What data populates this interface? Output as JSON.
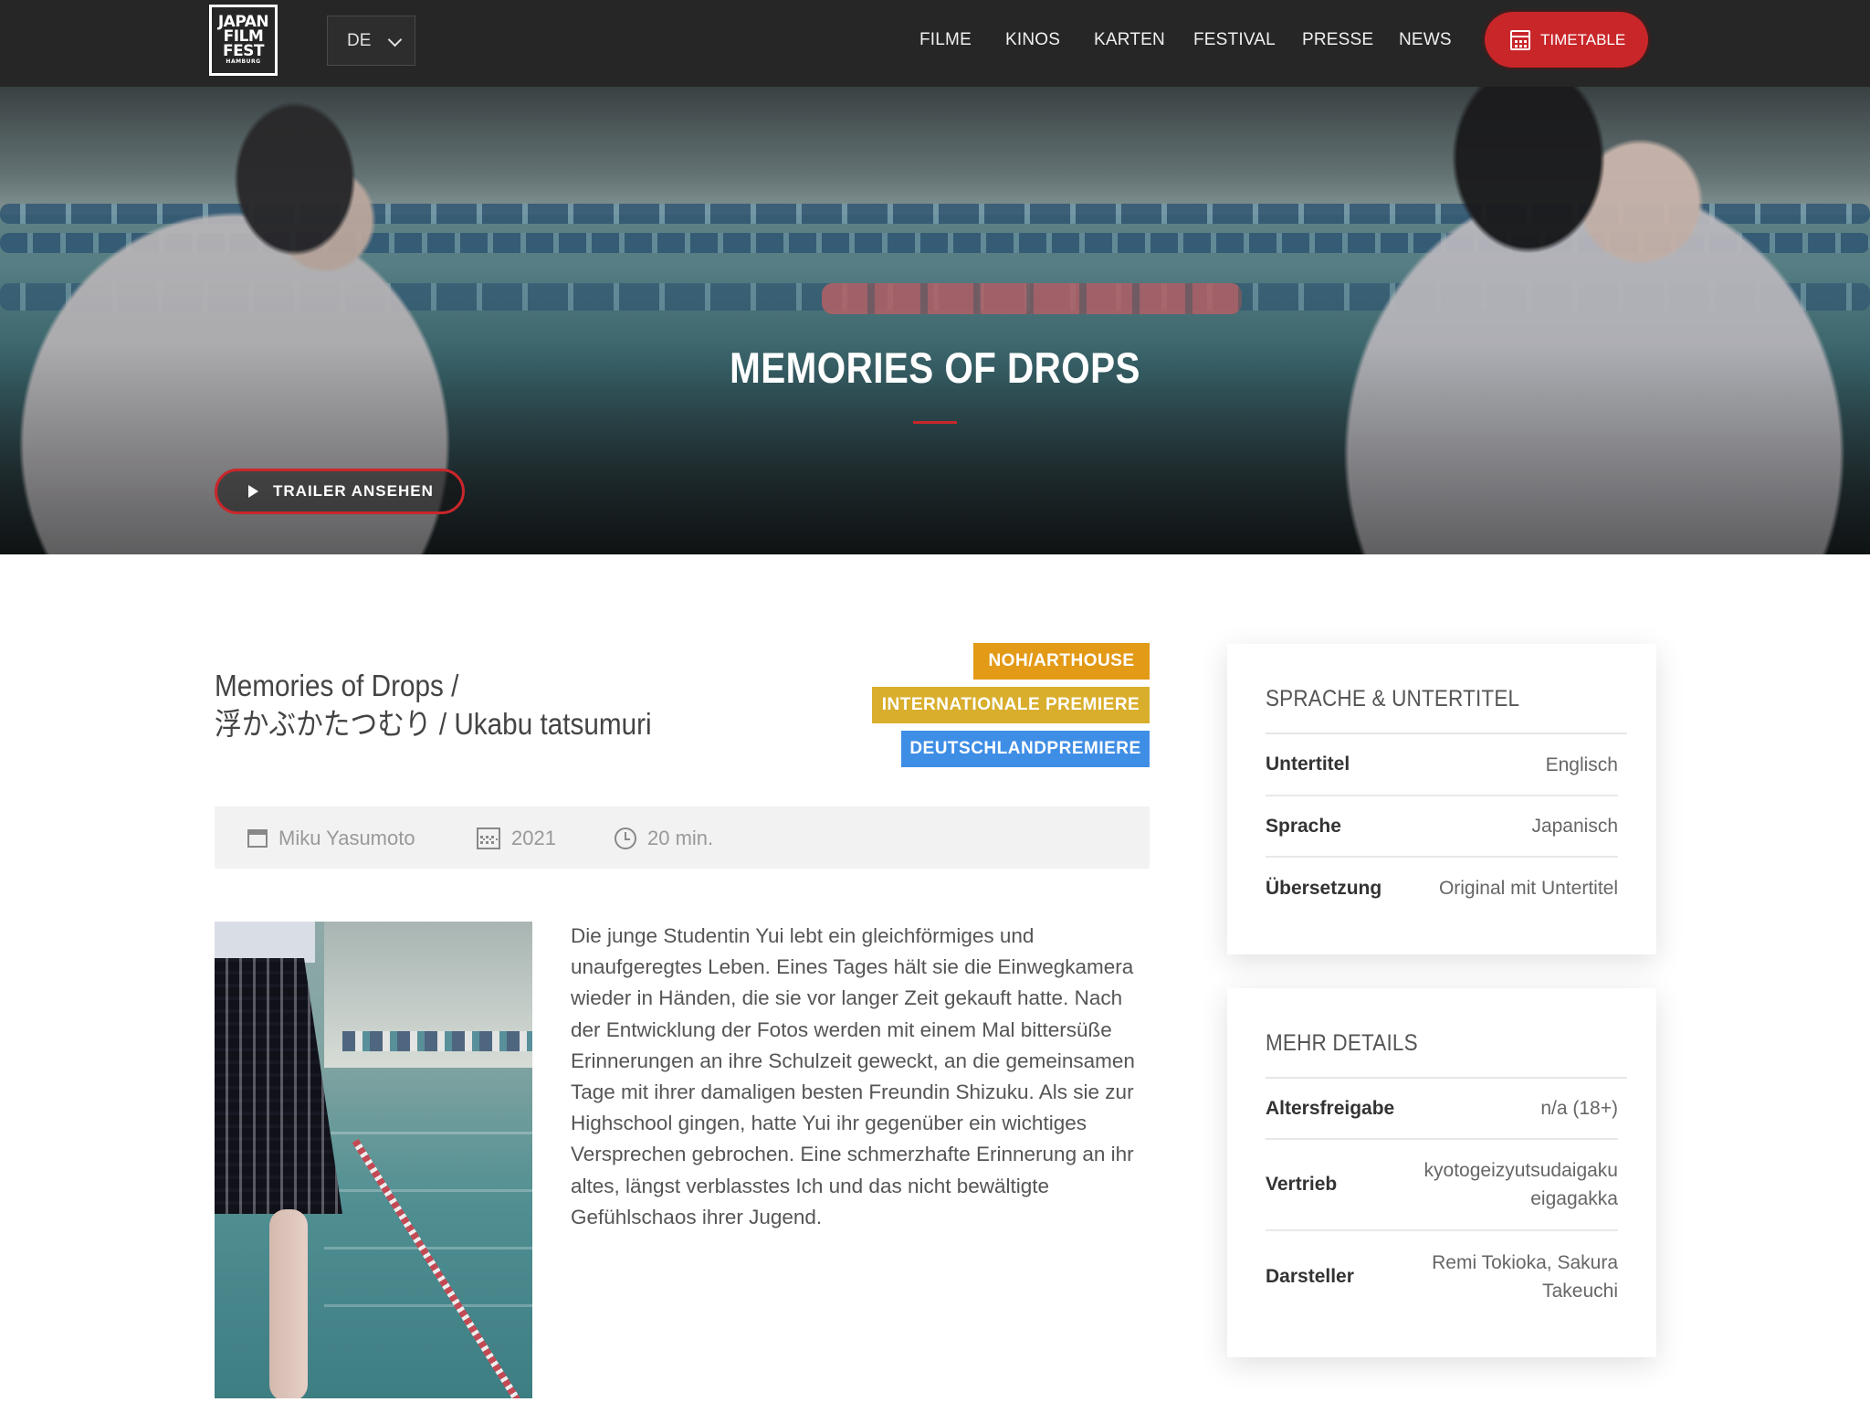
{
  "nav": {
    "logo_lines": [
      "JAPAN",
      "FILM",
      "FEST",
      "HAMBURG"
    ],
    "language": "DE",
    "menu": [
      "FILME",
      "KINOS",
      "KARTEN",
      "FESTIVAL",
      "PRESSE",
      "NEWS"
    ],
    "timetable_label": "TIMETABLE",
    "accent_color": "#c9262a"
  },
  "hero": {
    "title": "MEMORIES OF DROPS",
    "trailer_label": "TRAILER ANSEHEN"
  },
  "film": {
    "title_line1": "Memories of Drops  /",
    "title_line2": "浮かぶかたつむり  /  Ukabu tatsumuri",
    "badges": [
      {
        "label": "NOH/ARTHOUSE",
        "color": "#e39a17"
      },
      {
        "label": "INTERNATIONALE PREMIERE",
        "color": "#d9ae2d"
      },
      {
        "label": "DEUTSCHLANDPREMIERE",
        "color": "#3f8ee6"
      }
    ],
    "director": "Miku Yasumoto",
    "year": "2021",
    "duration": "20 min.",
    "description": "Die junge Studentin Yui lebt ein gleichförmiges und unaufgeregtes Leben. Eines Tages hält sie die Einwegkamera wieder in Händen, die sie vor langer Zeit gekauft hatte. Nach der Entwicklung der Fotos werden mit einem Mal bittersüße Erinnerungen an ihre Schulzeit geweckt, an die gemeinsamen Tage mit ihrer damaligen besten Freundin Shizuku. Als sie zur Highschool gingen, hatte Yui ihr gegenüber ein wichtiges Versprechen gebrochen. Eine schmerzhafte Erinnerung an ihr altes, längst verblasstes Ich und das nicht bewältigte Gefühlschaos ihrer Jugend."
  },
  "language_card": {
    "title": "SPRACHE & UNTERTITEL",
    "rows": [
      {
        "key": "Untertitel",
        "value": "Englisch"
      },
      {
        "key": "Sprache",
        "value": "Japanisch"
      },
      {
        "key": "Übersetzung",
        "value": "Original mit Untertitel"
      }
    ]
  },
  "details_card": {
    "title": "MEHR DETAILS",
    "rows": [
      {
        "key": "Altersfreigabe",
        "value": "n/a (18+)"
      },
      {
        "key": "Vertrieb",
        "value_line1": "kyotogeizyutsudaigaku",
        "value_line2": "eigagakka"
      },
      {
        "key": "Darsteller",
        "value_line1": "Remi Tokioka, Sakura",
        "value_line2": "Takeuchi"
      }
    ]
  }
}
